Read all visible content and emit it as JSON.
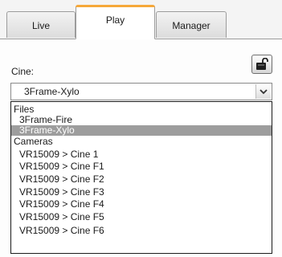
{
  "tabs": {
    "live": "Live",
    "play": "Play",
    "manager": "Manager"
  },
  "cine": {
    "label": "Cine:",
    "selected_value": "3Frame-Xylo"
  },
  "lock_button": {
    "icon": "unlock-icon"
  },
  "dropdown": {
    "files_header": "Files",
    "files": [
      "3Frame-Fire",
      "3Frame-Xylo"
    ],
    "selected_file_index": 1,
    "cameras_header": "Cameras",
    "cameras": [
      "VR15009 > Cine 1",
      "VR15009 > Cine F1",
      "VR15009 > Cine F2",
      "VR15009 > Cine F3",
      "VR15009 > Cine F4",
      "VR15009 > Cine F5",
      "VR15009 > Cine F6"
    ]
  },
  "colors": {
    "active_tab_accent": "#f6a83a",
    "selection_background": "#9d9d9d"
  }
}
